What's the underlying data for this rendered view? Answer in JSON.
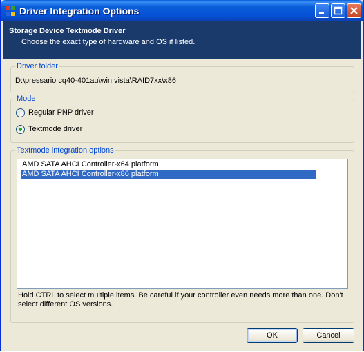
{
  "window": {
    "title": "Driver Integration Options"
  },
  "header": {
    "title": "Storage Device Textmode Driver",
    "subtitle": "Choose the exact type of hardware and OS if listed."
  },
  "driver_folder": {
    "label": "Driver folder",
    "path": "D:\\pressario cq40-401au\\win vista\\RAID7xx\\x86"
  },
  "mode": {
    "label": "Mode",
    "options": [
      {
        "label": "Regular PNP driver",
        "selected": false
      },
      {
        "label": "Textmode driver",
        "selected": true
      }
    ]
  },
  "textmode_options": {
    "label": "Textmode integration options",
    "items": [
      {
        "label": "AMD SATA AHCI Controller-x64 platform",
        "selected": false
      },
      {
        "label": "AMD SATA AHCI Controller-x86 platform",
        "selected": true
      }
    ],
    "hint": "Hold CTRL to select multiple items. Be careful if your controller even needs more than one. Don't select different OS versions."
  },
  "buttons": {
    "ok": "OK",
    "cancel": "Cancel"
  },
  "colors": {
    "header_bg": "#1a3a6b",
    "selection": "#316ac5",
    "group_label": "#0046d5",
    "dialog_bg": "#ece9d8"
  }
}
